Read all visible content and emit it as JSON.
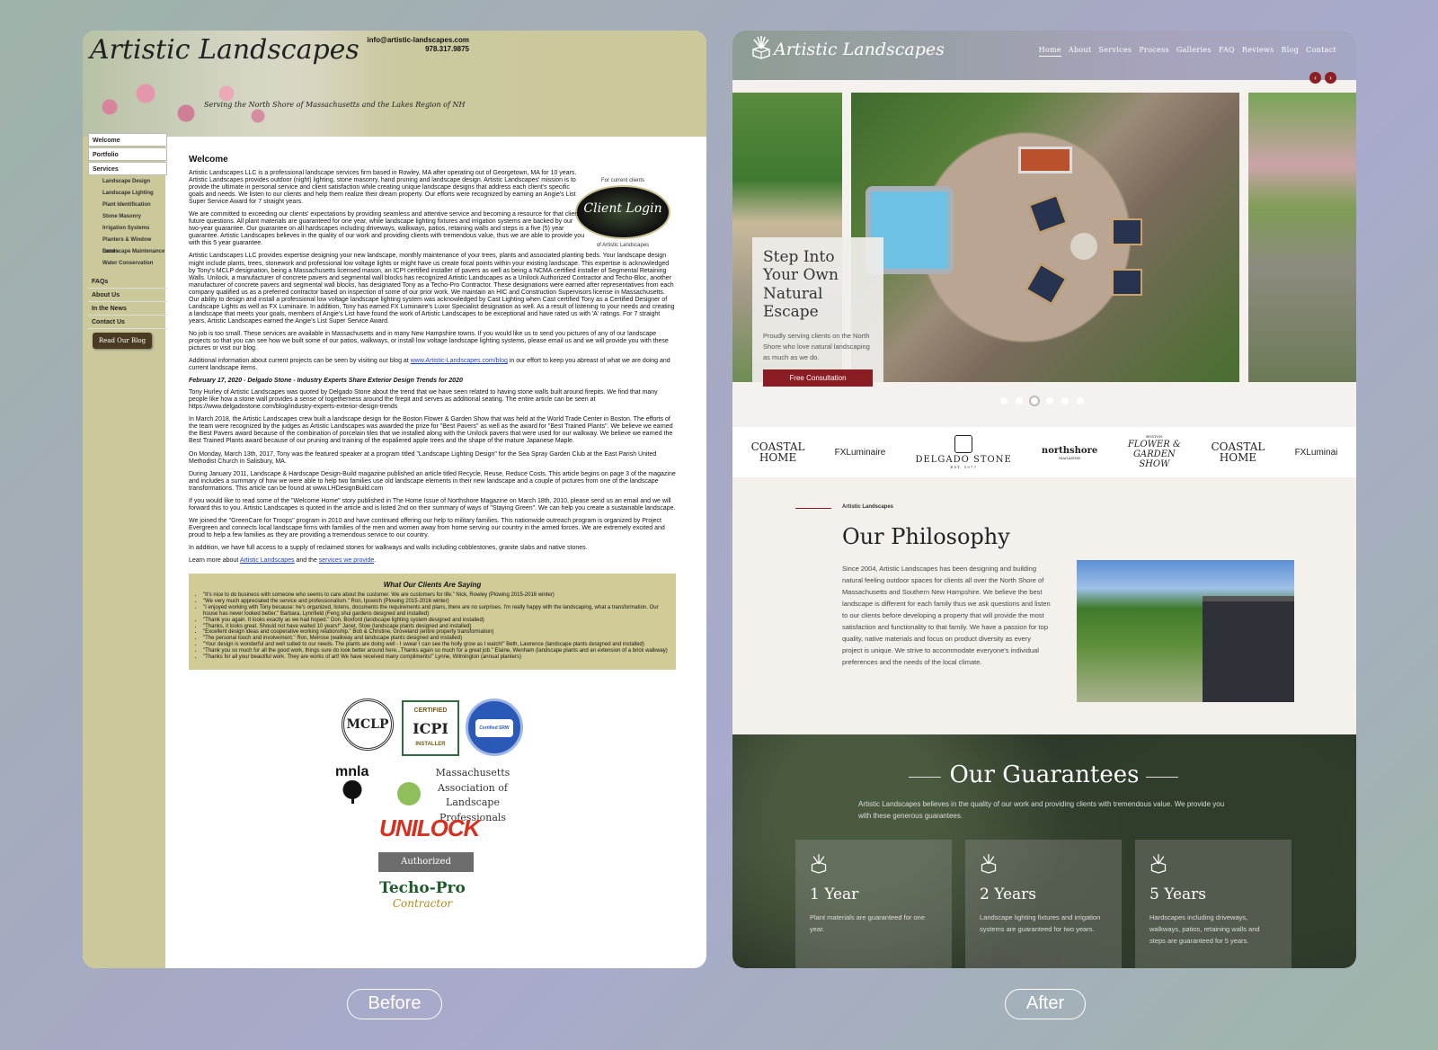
{
  "old_site": {
    "logo": "Artistic Landscapes",
    "email": "info@artistic-landscapes.com",
    "phone": "978.317.9875",
    "tagline": "Serving the North Shore of Massachusetts and the Lakes Region of NH",
    "nav_top": [
      "Welcome",
      "Portfolio",
      "Services"
    ],
    "nav_sub": [
      "Landscape Design",
      "Landscape Lighting",
      "Plant Identification",
      "Stone Masonry",
      "Irrigation Systems",
      "Planters & Window Boxes",
      "Landscape Maintenance",
      "Water Conservation"
    ],
    "nav_lower": [
      "FAQs",
      "About Us",
      "In the News",
      "Contact Us"
    ],
    "blog_button": "Read Our Blog",
    "heading": "Welcome",
    "client_login": {
      "top": "For current clients",
      "main": "Client Login",
      "bottom": "of Artistic Landscapes"
    },
    "paragraphs": [
      "Artistic Landscapes LLC is a professional landscape services firm based in Rowley, MA after operating out of Georgetown, MA for 10 years. Artistic Landscapes provides outdoor (night) lighting, stone masonry, hand pruning and landscape design. Artistic Landscapes' mission is to provide the ultimate in personal service and client satisfaction while creating unique landscape designs that address each client's specific goals and needs. We listen to our clients and help them realize their dream property. Our efforts were recognized by earning an Angie's List Super Service Award for 7 straight years.",
      "We are committed to exceeding our clients' expectations by providing seamless and attentive service and becoming a resource for that client's future questions. All plant materials are guaranteed for one year, while landscape lighting fixtures and irrigation systems are backed by our two-year guarantee. Our guarantee on all hardscapes including driveways, walkways, patios, retaining walls and steps is a five (5) year guarantee. Artistic Landscapes believes in the quality of our work and providing clients with tremendous value, thus we are able to provide you with this 5 year guarantee.",
      "Artistic Landscapes LLC provides expertise designing your new landscape, monthly maintenance of your trees, plants and associated planting beds. Your landscape design might include plants, trees, stonework and professional low voltage lights or might have us create focal points within your existing landscape. This expertise is acknowledged by Tony's MCLP designation, being a Massachusetts licensed mason, an ICPI certified installer of pavers as well as being a NCMA certified installer of Segmental Retaining Walls. Unilock, a manufacturer of concrete pavers and segmental wall blocks has recognized Artistic Landscapes as a Unilock Authorized Contractor and Techo-Bloc, another manufacturer of concrete pavers and segmental wall blocks, has designated Tony as a Techo-Pro Contractor. These designations were earned after representatives from each company qualified us as a preferred contractor based on inspection of some of our prior work. We maintain an HIC and Construction Supervisors license in Massachusetts. Our ability to design and install a professional low voltage landscape lighting system was acknowledged by Cast Lighting when Cast certified Tony as a Certified Designer of Landscape Lights as well as FX Luminaire. In addition, Tony has earned FX Luminaire's Luxor Specialist designation as well. As a result of listening to your needs and creating a landscape that meets your goals, members of Angie's List have found the work of Artistic Landscapes to be exceptional and have rated us with 'A' ratings. For 7 straight years, Artistic Landscapes earned the Angie's List Super Service Award.",
      "No job is too small. These services are available in Massachusetts and in many New Hampshire towns. If you would like us to send you pictures of any of our landscape projects so that you can see how we built some of our patios, walkways, or install low voltage landscape lighting systems, please email us and we will provide you with these pictures or visit our blog."
    ],
    "blog_para_pre": "Additional information about current projects can be seen by visiting our blog at ",
    "blog_link": "www.Artistic-Landscapes.com/blog",
    "blog_para_post": " in our effort to keep you abreast of what we are doing and current landscape items.",
    "news_date": "February 17, 2020 - Delgado Stone - Industry Experts Share Exterior Design Trends for 2020",
    "news_paragraphs": [
      "Tony Hurley of Artistic Landscapes was quoted by Delgado Stone about the trend that we have seen related to having stone walls built around firepits. We find that many people like how a stone wall provides a sense of togetherness around the firepit and serves as additional seating. The entire article can be seen at https://www.delgadostone.com/blog/industry-experts-exterior-design-trends",
      "In March 2018, the Artistic Landscapes crew built a landscape design for the Boston Flower & Garden Show that was held at the World Trade Center in Boston. The efforts of the team were recognized by the judges as Artistic Landscapes was awarded the prize for \"Best Pavers\" as well as the award for \"Best Trained Plants\". We believe we earned the Best Pavers award because of the combination of porcelain tiles that we installed along with the Unilock pavers that were used for our walkway. We believe we earned the Best Trained Plants award because of our pruning and training of the espaliered apple trees and the shape of the mature Japanese Maple.",
      "On Monday, March 13th, 2017, Tony was the featured speaker at a program titled \"Landscape Lighting Design\" for the Sea Spray Garden Club at the East Parish United Methodist Church in Salisbury, MA.",
      "During January 2011, Landscape & Hardscape Design-Build magazine published an article titled Recycle, Reuse, Reduce Costs. This article begins on page 3 of the magazine and includes a summary of how we were able to help two families use old landscape elements in their new landscape and a couple of pictures from one of the landscape transformations. This article can be found at www.LHDesignBuild.com",
      "If you would like to read some of the \"Welcome Home\" story published in The Home Issue of Northshore Magazine on March 18th, 2010, please send us an email and we will forward this to you. Artistic Landscapes is quoted in the article and is listed 2nd on their summary of ways of \"Staying Green\". We can help you create a sustainable landscape.",
      "We joined the \"GreenCare for Troops\" program in 2010 and have continued offering our help to military families. This nationwide outreach program is organized by Project Evergreen and connects local landscape firms with families of the men and women away from home serving our country in the armed forces. We are extremely excited and proud to help a few families as they are providing a tremendous service to our country.",
      "In addition, we have full access to a supply of reclaimed stones for walkways and walls including cobblestones, granite slabs and native stones."
    ],
    "learn_more": {
      "pre": "Learn more about ",
      "link1": "Artistic Landscapes",
      "mid": " and the ",
      "link2": "services we provide",
      "post": "."
    },
    "testimonials_title": "What Our Clients Are Saying",
    "testimonials": [
      "\"It's nice to do business with someone who seems to care about the customer. We are customers for life.\" Nick, Rowley (Plowing 2015-2016 winter)",
      "\"We very much appreciated the service and professionalism.\" Ron, Ipswich (Plowing 2015-2016 winter)",
      "\"I enjoyed working with Tony because: he's organized, listens, documents the requirements and plans, there are no surprises. I'm really happy with the landscaping, what a transformation. Our house has never looked better.\" Barbara, Lynnfield (Feng shui gardens designed and installed)",
      "\"Thank you again. It looks exactly as we had hoped.\" Don, Boxford (landscape lighting system designed and installed)",
      "\"Thanks, it looks great. Should not have waited 10 years!\" Janet, Stow (landscape plants designed and installed)",
      "\"Excellent design ideas and cooperative working relationship.\" Bob & Christine, Groveland (entire property transformation)",
      "\"The personal touch and involvement.\" Ron, Melrose (walkway and landscape plants designed and installed)",
      "\"Your design is wonderful and well suited to our needs. The plants are doing well - I swear I can see the holly grow as I watch!\" Beth, Lawrence (landscape plants designed and installed)",
      "\"Thank you so much for all the good work, things sure do look better around here...Thanks again so much for a great job.\" Elaine, Wenham (landscape plants and an extension of a brick walkway)",
      "\"Thanks for all your beautiful work. They are works of art! We have received many compliments!\" Lynne, Wilmington (annual planters)"
    ],
    "badges": {
      "mclp": "MCLP",
      "icpi": "ICPI",
      "icpi_top": "CERTIFIED",
      "icpi_bottom": "INSTALLER",
      "srw": "Certified SRW Installer",
      "mnla": "mnla",
      "massachusetts_assoc": "Massachusetts Association of Landscape Professionals",
      "unilock": "UNILOCK",
      "unilock_sub": "Authorized Contractor",
      "techo": "Techo-Pro",
      "techo_sub": "Contractor"
    }
  },
  "new_site": {
    "logo": "Artistic Landscapes",
    "nav": [
      "Home",
      "About",
      "Services",
      "Process",
      "Galleries",
      "FAQ",
      "Reviews",
      "Blog",
      "Contact"
    ],
    "nav_active": "Home",
    "arrow_prev": "‹",
    "arrow_next": "›",
    "hero_title": "Step Into Your Own Natural Escape",
    "hero_text": "Proudly serving clients on the North Shore who love natural landscaping as much as we do.",
    "hero_button": "Free Consultation",
    "slider_dots": 6,
    "slider_active": 3,
    "partners": [
      "COASTAL HOME",
      "FXLuminaire",
      "DELGADO STONE",
      "northshore",
      "FLOWER & GARDEN SHOW",
      "COASTAL HOME",
      "FXLuminai"
    ],
    "partner_delgado_year": "EST. 1977",
    "partner_northshore_sub": "MAGAZINE",
    "partner_flower_top": "BOSTON",
    "philosophy_eyebrow": "Artistic Landscapes",
    "philosophy_title": "Our Philosophy",
    "philosophy_text": "Since 2004, Artistic Landscapes has been designing and building natural feeling outdoor spaces for clients all over the North Shore of Massachusetts and Southern New Hampshire. We believe the best landscape is different for each family thus we ask questions and listen to our clients before developing a property that will provide the most satisfaction and functionality to that family. We have a passion for top quality, native materials and focus on product diversity as every project is unique. We strive to accommodate everyone's individual preferences and the needs of the local climate.",
    "guarantee_title": "Our Guarantees",
    "guarantee_sub": "Artistic Landscapes believes in the quality of our work and providing clients with tremendous value. We provide you with these generous guarantees.",
    "guarantees": [
      {
        "title": "1 Year",
        "text": "Plant materials are guaranteed for one year."
      },
      {
        "title": "2 Years",
        "text": "Landscape lighting fixtures and irrigation systems are guaranteed for two years."
      },
      {
        "title": "5 Years",
        "text": "Hardscapes including driveways, walkways, patios, retaining walls and steps are guaranteed for 5 years."
      }
    ]
  },
  "labels": {
    "before": "Before",
    "after": "After"
  }
}
